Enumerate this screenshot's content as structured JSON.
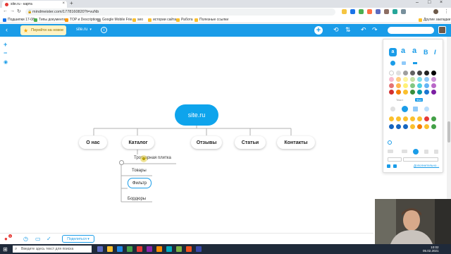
{
  "browser": {
    "tab_title": "site.ru - карта",
    "new_tab": "+",
    "url": "mindmeister.com/1778160820?t=vuNb",
    "bookmarks": [
      "Подшипки 17-08",
      "Типы документа",
      "TOP и Description",
      "Google Mobile Frie...",
      "seo",
      "истории сайта",
      "Работа",
      "Полезные ссылки"
    ],
    "other_bookmarks": "Другие закладки"
  },
  "toolbar": {
    "upgrade_label": "Перейти на новое",
    "map_name": "site.ru",
    "search_placeholder": ""
  },
  "mindmap": {
    "root": "site.ru",
    "branches": [
      "О нас",
      "Каталог",
      "Отзывы",
      "Статьи",
      "Контакты"
    ],
    "catalog_children": [
      "Тротуарная плитка",
      "Товары",
      "Фильтр",
      "Бордюры"
    ]
  },
  "panel": {
    "font_styles": [
      "a",
      "a",
      "a",
      "B",
      "I"
    ],
    "colors": [
      "#ffffff",
      "#e0e0e0",
      "#9e9e9e",
      "#616161",
      "#424242",
      "#212121",
      "#000000",
      "#f8bbd0",
      "#ffcc80",
      "#fff59d",
      "#c5e1a5",
      "#80deea",
      "#90caf9",
      "#ce93d8",
      "#e57373",
      "#ffb74d",
      "#fff176",
      "#81c784",
      "#4dd0e1",
      "#64b5f6",
      "#ba68c8",
      "#d32f2f",
      "#f57c00",
      "#fbc02d",
      "#388e3c",
      "#0097a7",
      "#1976d2",
      "#7b1fa2"
    ],
    "label_text": "Текст",
    "label_bg": "Фон",
    "more_link": "Дополнительно..."
  },
  "bottombar": {
    "share_label": "Поделиться ▾",
    "badge": "1"
  },
  "taskbar": {
    "search_placeholder": "Введите здесь текст для поиска",
    "time": "10:02",
    "date": "05.02.2021"
  }
}
